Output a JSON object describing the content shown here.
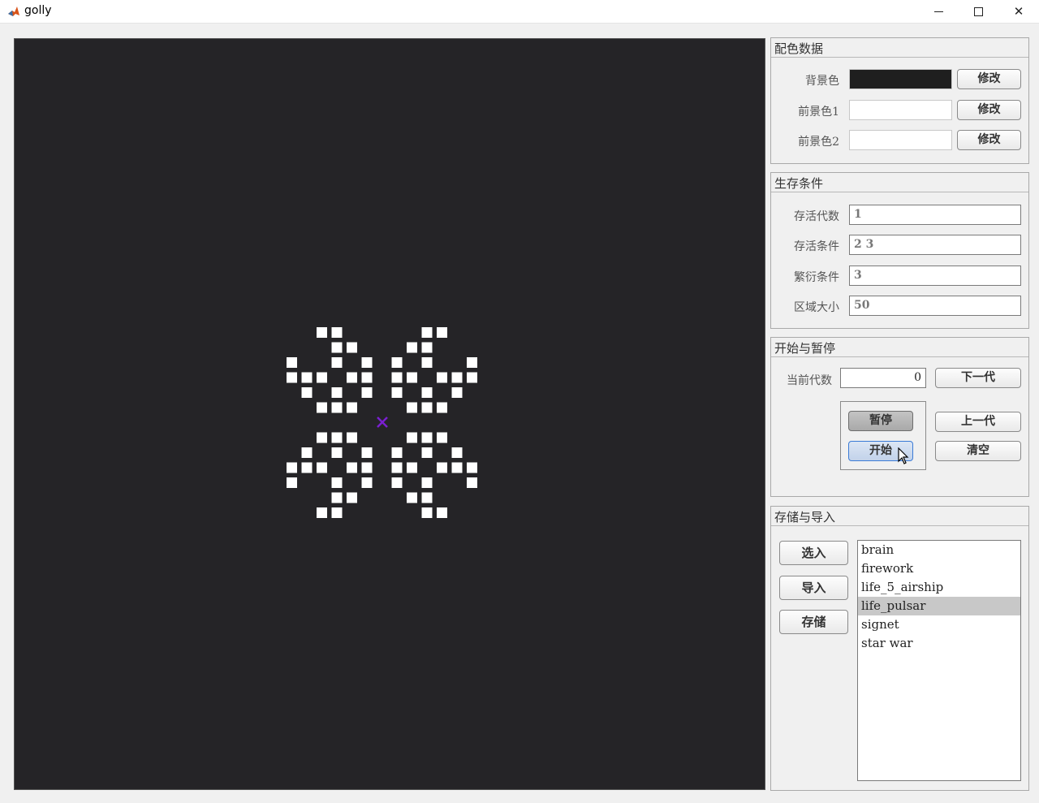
{
  "window": {
    "title": "golly",
    "minimize_icon": "minimize-icon",
    "maximize_icon": "maximize-icon",
    "close_icon": "close-icon",
    "close_glyph": "✕"
  },
  "board": {
    "background": "#252427",
    "cell_color": "#ffffff",
    "marker_color": "#7a1fd0",
    "marker_icon": "center-cross-icon",
    "cells": [
      [
        2,
        0
      ],
      [
        3,
        0
      ],
      [
        3,
        1
      ],
      [
        4,
        1
      ],
      [
        0,
        2
      ],
      [
        3,
        2
      ],
      [
        5,
        2
      ],
      [
        0,
        3
      ],
      [
        1,
        3
      ],
      [
        2,
        3
      ],
      [
        4,
        3
      ],
      [
        5,
        3
      ],
      [
        1,
        4
      ],
      [
        3,
        4
      ],
      [
        5,
        4
      ],
      [
        2,
        5
      ],
      [
        3,
        5
      ],
      [
        4,
        5
      ],
      [
        9,
        0
      ],
      [
        10,
        0
      ],
      [
        8,
        1
      ],
      [
        9,
        1
      ],
      [
        7,
        2
      ],
      [
        9,
        2
      ],
      [
        12,
        2
      ],
      [
        7,
        3
      ],
      [
        8,
        3
      ],
      [
        10,
        3
      ],
      [
        11,
        3
      ],
      [
        12,
        3
      ],
      [
        7,
        4
      ],
      [
        9,
        4
      ],
      [
        11,
        4
      ],
      [
        8,
        5
      ],
      [
        9,
        5
      ],
      [
        10,
        5
      ],
      [
        2,
        7
      ],
      [
        3,
        7
      ],
      [
        4,
        7
      ],
      [
        1,
        8
      ],
      [
        3,
        8
      ],
      [
        5,
        8
      ],
      [
        0,
        9
      ],
      [
        1,
        9
      ],
      [
        2,
        9
      ],
      [
        4,
        9
      ],
      [
        5,
        9
      ],
      [
        0,
        10
      ],
      [
        3,
        10
      ],
      [
        5,
        10
      ],
      [
        3,
        11
      ],
      [
        4,
        11
      ],
      [
        2,
        12
      ],
      [
        3,
        12
      ],
      [
        8,
        7
      ],
      [
        9,
        7
      ],
      [
        10,
        7
      ],
      [
        7,
        8
      ],
      [
        9,
        8
      ],
      [
        11,
        8
      ],
      [
        7,
        9
      ],
      [
        8,
        9
      ],
      [
        10,
        9
      ],
      [
        11,
        9
      ],
      [
        12,
        9
      ],
      [
        7,
        10
      ],
      [
        9,
        10
      ],
      [
        12,
        10
      ],
      [
        8,
        11
      ],
      [
        9,
        11
      ],
      [
        9,
        12
      ],
      [
        10,
        12
      ]
    ]
  },
  "color_panel": {
    "title": "配色数据",
    "rows": [
      {
        "label": "背景色",
        "color": "#1f1f1f",
        "button": "修改"
      },
      {
        "label": "前景色1",
        "color": "#ffffff",
        "button": "修改"
      },
      {
        "label": "前景色2",
        "color": "#ffffff",
        "button": "修改"
      }
    ]
  },
  "survival_panel": {
    "title": "生存条件",
    "rows": [
      {
        "label": "存活代数",
        "value": "1"
      },
      {
        "label": "存活条件",
        "value": "2 3"
      },
      {
        "label": "繁衍条件",
        "value": "3"
      },
      {
        "label": "区域大小",
        "value": "50"
      }
    ]
  },
  "run_panel": {
    "title": "开始与暂停",
    "generation_label": "当前代数",
    "generation_value": "0",
    "next_button": "下一代",
    "pause_button": "暂停",
    "start_button": "开始",
    "prev_button": "上一代",
    "clear_button": "清空"
  },
  "io_panel": {
    "title": "存储与导入",
    "select_button": "选入",
    "import_button": "导入",
    "save_button": "存储",
    "files": [
      "brain",
      "firework",
      "life_5_airship",
      "life_pulsar",
      "signet",
      "star war"
    ],
    "selected_file": "life_pulsar"
  }
}
